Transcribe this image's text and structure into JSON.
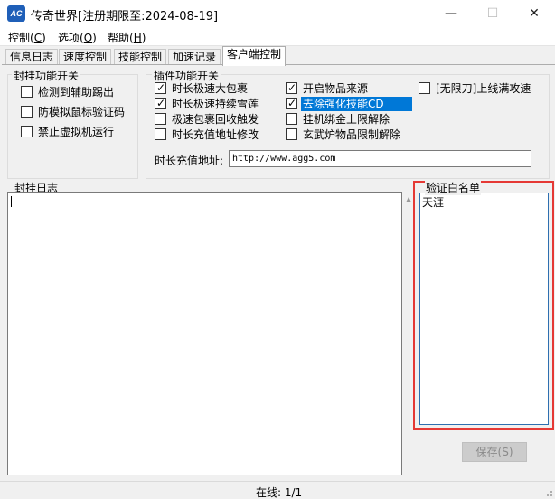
{
  "window": {
    "icon_text": "AC",
    "title": "传奇世界[注册期限至:2024-08-19]",
    "minimize_glyph": "—",
    "maximize_glyph": "☐",
    "close_glyph": "✕"
  },
  "menu": [
    {
      "label": "控制(",
      "key": "C",
      "end": ")"
    },
    {
      "label": "选项(",
      "key": "O",
      "end": ")"
    },
    {
      "label": "帮助(",
      "key": "H",
      "end": ")"
    }
  ],
  "tabs": [
    "信息日志",
    "速度控制",
    "技能控制",
    "加速记录",
    "客户端控制"
  ],
  "active_tab_index": 4,
  "anti_hang": {
    "title": "封挂功能开关",
    "options": [
      {
        "label": "检测到辅助踢出",
        "checked": false
      },
      {
        "label": "防模拟鼠标验证码",
        "checked": false
      },
      {
        "label": "禁止虚拟机运行",
        "checked": false
      }
    ]
  },
  "plugin": {
    "title": "插件功能开关",
    "col1": [
      {
        "label": "时长极速大包裹",
        "checked": true
      },
      {
        "label": "时长极速持续雪莲",
        "checked": true
      },
      {
        "label": "极速包裹回收触发",
        "checked": false
      },
      {
        "label": "时长充值地址修改",
        "checked": false
      }
    ],
    "col2": [
      {
        "label": "开启物品来源",
        "checked": true
      },
      {
        "label": "去除强化技能CD",
        "checked": true,
        "selected": true
      },
      {
        "label": "挂机绑金上限解除",
        "checked": false
      },
      {
        "label": "玄武炉物品限制解除",
        "checked": false
      }
    ],
    "col3": [
      {
        "label": "[无限刀]上线满攻速",
        "checked": false
      }
    ],
    "address_label": "时长充值地址:",
    "address_value": "http://www.agg5.com"
  },
  "log": {
    "title": "封挂日志",
    "content": ""
  },
  "whitelist": {
    "title": "验证白名单",
    "items": [
      "天涯"
    ]
  },
  "save_button": {
    "label": "保存(",
    "key": "S",
    "end": ")",
    "enabled": false
  },
  "status": {
    "text": "在线: 1/1"
  },
  "colors": {
    "highlight_border": "#e53935",
    "selection": "#0078d7",
    "list_border": "#2e6fb0"
  }
}
